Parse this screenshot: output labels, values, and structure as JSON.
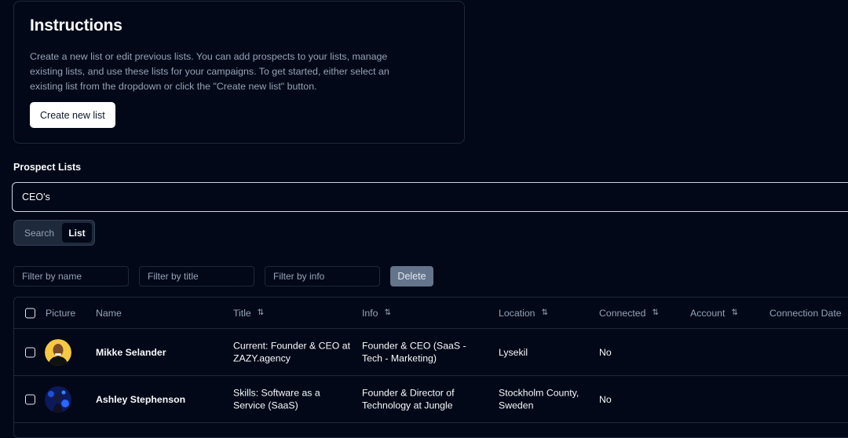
{
  "instructions": {
    "title": "Instructions",
    "body": "Create a new list or edit previous lists. You can add prospects to your lists, manage existing lists, and use these lists for your campaigns. To get started, either select an existing list from the dropdown or click the \"Create new list\" button.",
    "create_button": "Create new list"
  },
  "prospect_lists": {
    "label": "Prospect Lists",
    "selected": "CEO's"
  },
  "view_toggle": {
    "options": [
      "Search",
      "List"
    ],
    "active": "List"
  },
  "filters": {
    "name_placeholder": "Filter by name",
    "title_placeholder": "Filter by title",
    "info_placeholder": "Filter by info",
    "delete_button": "Delete"
  },
  "table": {
    "columns": [
      "Picture",
      "Name",
      "Title",
      "Info",
      "Location",
      "Connected",
      "Account",
      "Connection Date"
    ],
    "rows": [
      {
        "name": "Mikke Selander",
        "title": "Current: Founder & CEO at ZAZY.agency",
        "info": "Founder & CEO (SaaS - Tech - Marketing)",
        "location": "Lysekil",
        "connected": "No",
        "account": "",
        "connection_date": ""
      },
      {
        "name": "Ashley Stephenson",
        "title": "Skills: Software as a Service (SaaS)",
        "info": "Founder & Director of Technology at Jungle",
        "location": "Stockholm County, Sweden",
        "connected": "No",
        "account": "",
        "connection_date": ""
      }
    ]
  },
  "colors": {
    "background": "#020817",
    "border": "#1e293b",
    "muted_text": "#94a3b8",
    "delete_button": "#64748b"
  }
}
